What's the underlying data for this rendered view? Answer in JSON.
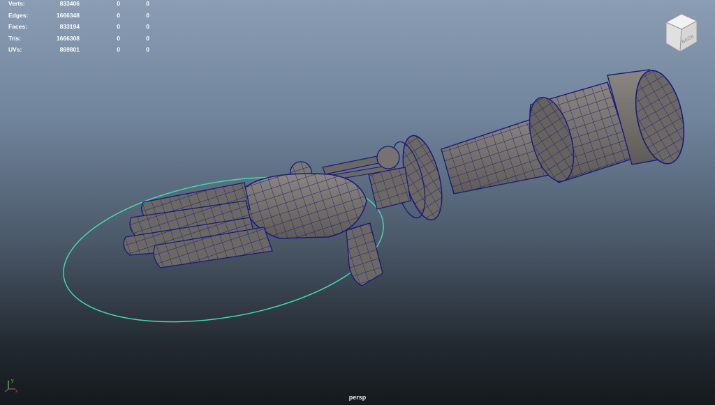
{
  "hud": {
    "rows": [
      {
        "label": "Verts:",
        "v1": "833406",
        "v2": "0",
        "v3": "0"
      },
      {
        "label": "Edges:",
        "v1": "1666348",
        "v2": "0",
        "v3": "0"
      },
      {
        "label": "Faces:",
        "v1": "833194",
        "v2": "0",
        "v3": "0"
      },
      {
        "label": "Tris:",
        "v1": "1666308",
        "v2": "0",
        "v3": "0"
      },
      {
        "label": "UVs:",
        "v1": "869801",
        "v2": "0",
        "v3": "0"
      }
    ]
  },
  "viewcube": {
    "face_label": "BACK"
  },
  "camera": {
    "label": "persp"
  },
  "axis": {
    "y_label": "y",
    "x_label": "x"
  },
  "colors": {
    "wire": "#1a1a7a",
    "mesh_fill": "#75726f",
    "mesh_shade": "#57544f",
    "controller": "#3fd9a8",
    "axis_x": "#e03a3a",
    "axis_y": "#3adb5a",
    "axis_z": "#3a6fe0"
  }
}
